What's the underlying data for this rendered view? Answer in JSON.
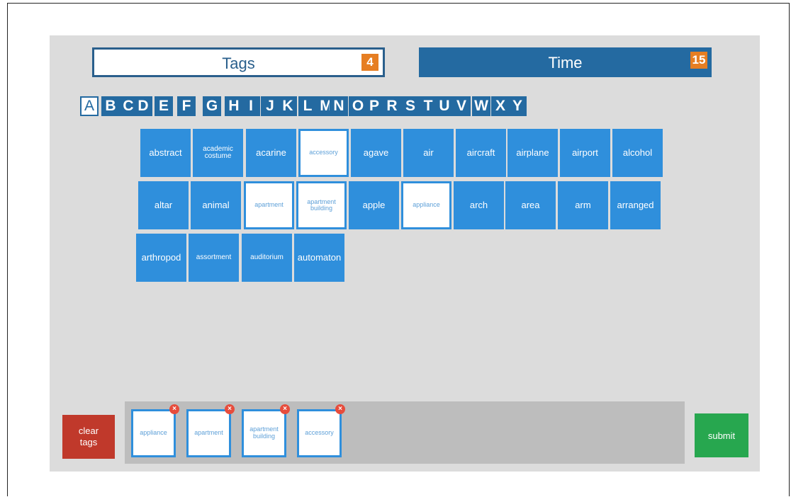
{
  "header": {
    "tags_label": "Tags",
    "tags_count": "4",
    "time_label": "Time",
    "time_value": "15"
  },
  "letters": [
    "A",
    "B",
    "C",
    "D",
    "E",
    "F",
    "G",
    "H",
    "I",
    "J",
    "K",
    "L",
    "M",
    "N",
    "O",
    "P",
    "R",
    "S",
    "T",
    "U",
    "V",
    "W",
    "X",
    "Y"
  ],
  "active_letter": "A",
  "tiles": [
    {
      "label": "abstract",
      "selected": false
    },
    {
      "label": "academic costume",
      "selected": false
    },
    {
      "label": "acarine",
      "selected": false
    },
    {
      "label": "accessory",
      "selected": true
    },
    {
      "label": "agave",
      "selected": false
    },
    {
      "label": "air",
      "selected": false
    },
    {
      "label": "aircraft",
      "selected": false
    },
    {
      "label": "airplane",
      "selected": false
    },
    {
      "label": "airport",
      "selected": false
    },
    {
      "label": "alcohol",
      "selected": false
    },
    {
      "label": "altar",
      "selected": false
    },
    {
      "label": "animal",
      "selected": false
    },
    {
      "label": "apartment",
      "selected": true
    },
    {
      "label": "apartment building",
      "selected": true
    },
    {
      "label": "apple",
      "selected": false
    },
    {
      "label": "appliance",
      "selected": true
    },
    {
      "label": "arch",
      "selected": false
    },
    {
      "label": "area",
      "selected": false
    },
    {
      "label": "arm",
      "selected": false
    },
    {
      "label": "arranged",
      "selected": false
    },
    {
      "label": "arthropod",
      "selected": false
    },
    {
      "label": "assortment",
      "selected": false
    },
    {
      "label": "auditorium",
      "selected": false
    },
    {
      "label": "automaton",
      "selected": false
    }
  ],
  "selected_tags": [
    "appliance",
    "apartment",
    "apartment building",
    "accessory"
  ],
  "buttons": {
    "clear_line1": "clear",
    "clear_line2": "tags",
    "submit": "submit"
  },
  "colors": {
    "accent_blue": "#246aa1",
    "tile_blue": "#2f8fdc",
    "orange": "#e67e22",
    "clear_red": "#c0392b",
    "submit_green": "#27a74f"
  }
}
